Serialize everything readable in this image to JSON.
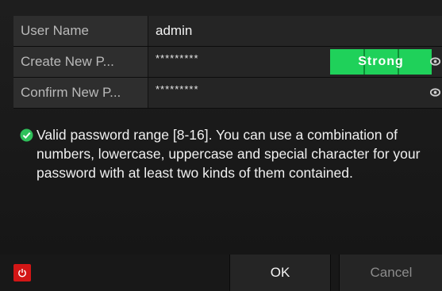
{
  "form": {
    "username": {
      "label": "User Name",
      "value": "admin"
    },
    "new_password": {
      "label": "Create New P...",
      "value": "*********",
      "strength": "Strong",
      "show_icon": "eye-icon"
    },
    "confirm_password": {
      "label": "Confirm New P...",
      "value": "*********",
      "show_icon": "eye-icon"
    }
  },
  "note": {
    "icon": "check-circle-icon",
    "text": "Valid password range [8-16]. You can use a combination of numbers, lowercase, uppercase and special character for your password with at least two kinds of them contained."
  },
  "footer": {
    "power_icon": "power-icon",
    "ok_label": "OK",
    "cancel_label": "Cancel"
  },
  "colors": {
    "strength_strong": "#1fd15a",
    "power": "#d21616",
    "check": "#2ec05a"
  }
}
